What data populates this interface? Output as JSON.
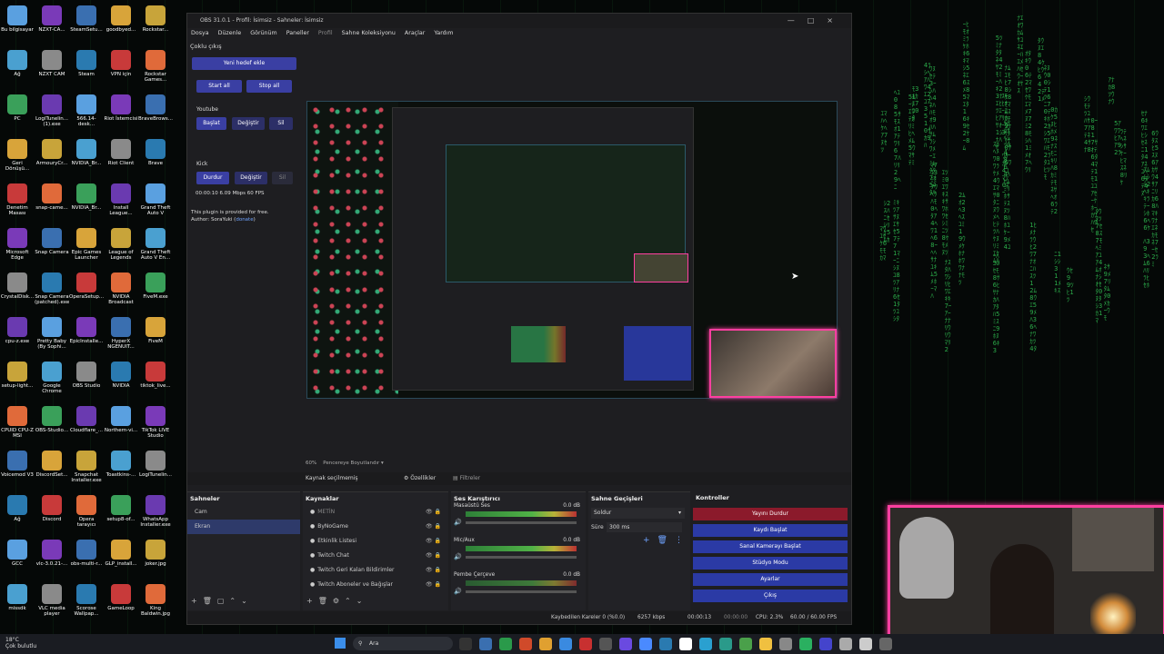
{
  "desktop_icons": [
    "Bu bilgisayar",
    "NZXT-CA...",
    "SteamSetu...",
    "goodbyed...",
    "Rockstar...",
    "Ağ",
    "NZXT CAM",
    "Steam",
    "VPN için",
    "Rockstar Games...",
    "PC",
    "LogiTunelin... (1).exe",
    "566.14-desk...",
    "Riot İstemcisi",
    "BraveBrows...",
    "Geri Dönüşü...",
    "ArmouryCr...",
    "NVIDIA_Br...",
    "Riot Client",
    "Brave",
    "Denetim Masası",
    "snap-came...",
    "NVIDIA_Br...",
    "Install League...",
    "Grand Theft Auto V",
    "Microsoft Edge",
    "Snap Camera",
    "Epic Games Launcher",
    "League of Legends",
    "Grand Theft Auto V En...",
    "CrystalDisk...",
    "Snap Camera (patched).exe",
    "OperaSetup...",
    "NVIDIA Broadcast",
    "FiveM.exe",
    "cpu-z.exe",
    "Pretty Baby (By Sophi...",
    "EpicInstalle...",
    "HyperX NGENUIT...",
    "FiveM",
    "setup-light...",
    "Google Chrome",
    "OBS Studio",
    "NVIDIA",
    "tiktok_live...",
    "CPUID CPU-Z MSI",
    "OBS-Studio...",
    "Cloudflare_...",
    "Northern-vi...",
    "TikTok LIVE Studio",
    "Voicemod V3",
    "DiscordSet...",
    "Snapchat Installer.exe",
    "Toastkins-...",
    "LogiTunelin...",
    "Ağ",
    "Discord",
    "Opera tarayıcı",
    "setup8-of...",
    "WhatsApp Installer.exe",
    "GCC",
    "vlc-3.0.21-...",
    "obs-multi-r...",
    "GLP_install...",
    "joker.jpg",
    "missdk",
    "VLC media player",
    "Scorose Wallpap...",
    "GameLoop",
    "King Baldwin.jpg"
  ],
  "window": {
    "title": "OBS 31.0.1 - Profil: İsimsiz - Sahneler: İsimsiz",
    "menu": [
      "Dosya",
      "Düzenle",
      "Görünüm",
      "Paneller",
      "Profil",
      "Sahne Koleksiyonu",
      "Araçlar",
      "Yardım"
    ]
  },
  "multistream": {
    "title": "Çoklu çıkış",
    "add_target": "Yeni hedef ekle",
    "start_all": "Start all",
    "stop_all": "Stop all",
    "youtube": {
      "name": "Youtube",
      "start": "Başlat",
      "edit": "Değiştir",
      "delete": "Sil"
    },
    "kick": {
      "name": "Kick",
      "stop": "Durdur",
      "edit": "Değiştir",
      "delete": "Sil",
      "stats": "00:00:10  6.09 Mbps  60 FPS"
    },
    "plugin_note": "This plugin is provided for free.",
    "author": "Author: SoraYuki",
    "donate": "donate"
  },
  "preview_bar": {
    "zoom": "60%",
    "mode": "Pencereye Boyutlandır"
  },
  "source_bar": {
    "label": "Kaynak seçilmemiş",
    "properties": "Özellikler",
    "filters": "Filtreler"
  },
  "scenes": {
    "title": "Sahneler",
    "items": [
      "Cam",
      "Ekran"
    ]
  },
  "sources": {
    "title": "Kaynaklar",
    "items": [
      "METİN",
      "ByNoGame",
      "Etkinlik Listesi",
      "Twitch Chat",
      "Twitch Geri Kalan Bildirimler",
      "Twitch Aboneler ve Bağışlar"
    ]
  },
  "mixer": {
    "title": "Ses Karıştırıcı",
    "channels": [
      {
        "name": "Masaüstü Ses",
        "db": "0.0 dB"
      },
      {
        "name": "Mic/Aux",
        "db": "0.0 dB"
      },
      {
        "name": "Pembe Çerçeve",
        "db": "0.0 dB"
      }
    ]
  },
  "transitions": {
    "title": "Sahne Geçişleri",
    "type": "Soldur",
    "duration_label": "Süre",
    "duration": "300 ms"
  },
  "controls": {
    "title": "Kontroller",
    "buttons": [
      "Yayını Durdur",
      "Kaydı Başlat",
      "Sanal Kamerayı Başlat",
      "Stüdyo Modu",
      "Ayarlar",
      "Çıkış"
    ]
  },
  "status": {
    "dropped": "Kaybedilen Kareler 0 (%0.0)",
    "bitrate": "6257 kbps",
    "stream_time": "00:00:13",
    "rec_time": "00:00:00",
    "cpu": "CPU: 2.3%",
    "fps": "60.00 / 60.00 FPS"
  },
  "taskbar": {
    "weather": "18°C",
    "weather_desc": "Çok bulutlu",
    "search": "Ara"
  },
  "colors": {
    "accent": "#3a3fa3",
    "stop": "#8b1a2b",
    "webcam_border": "#ff3fa0",
    "matrix": "#35d35a"
  }
}
